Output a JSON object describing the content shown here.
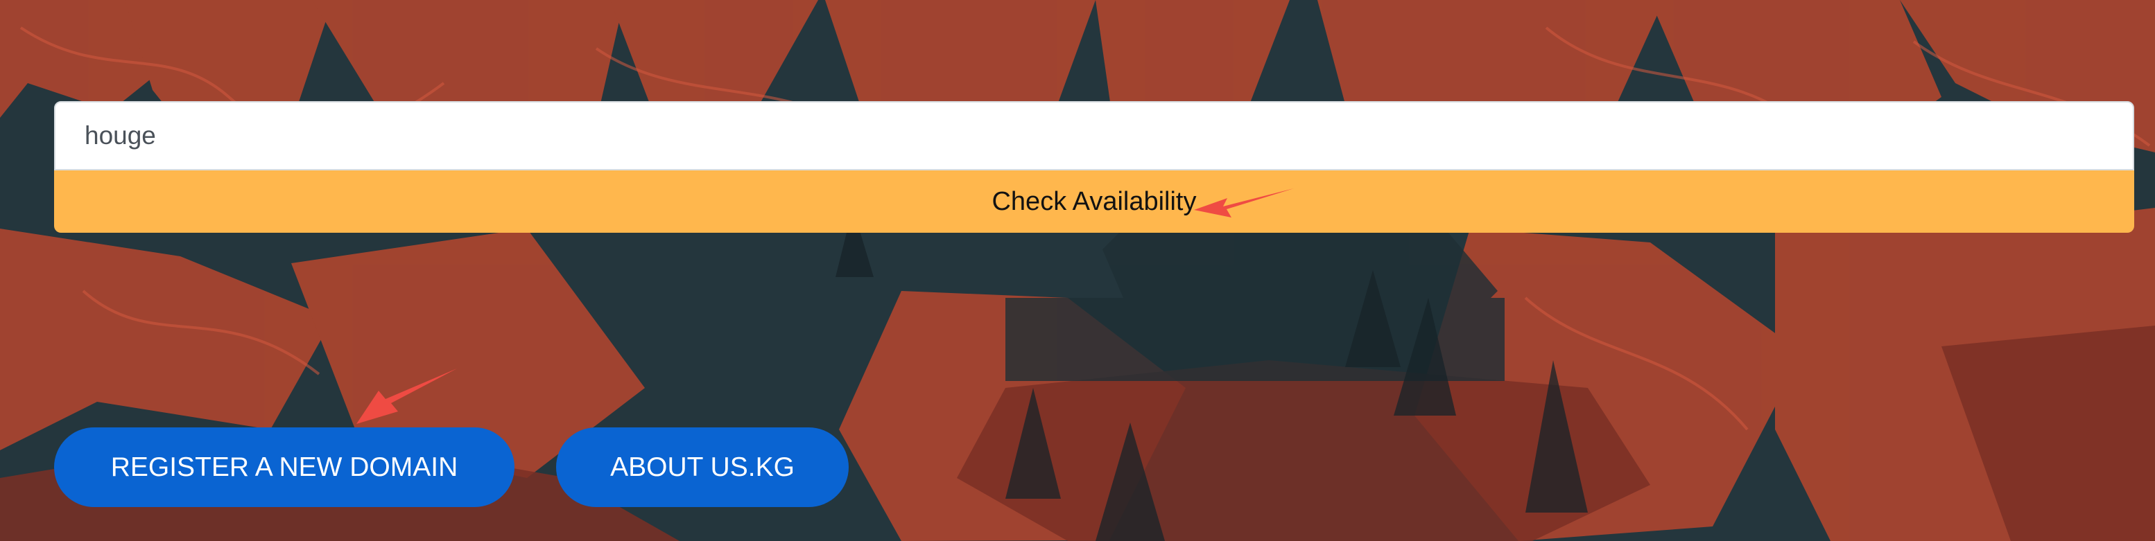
{
  "search": {
    "value": "houge"
  },
  "buttons": {
    "check_availability": "Check Availability",
    "register_domain": "REGISTER A NEW DOMAIN",
    "about": "ABOUT US.KG"
  },
  "colors": {
    "background": "#24363d",
    "forest_red": "#b94a35",
    "input_background": "#ffffff",
    "check_button": "#ffb74d",
    "primary_button": "#0a64d2",
    "annotation_arrow": "#ef4b43"
  },
  "icons": {
    "annotation_arrow": "arrow-icon"
  }
}
